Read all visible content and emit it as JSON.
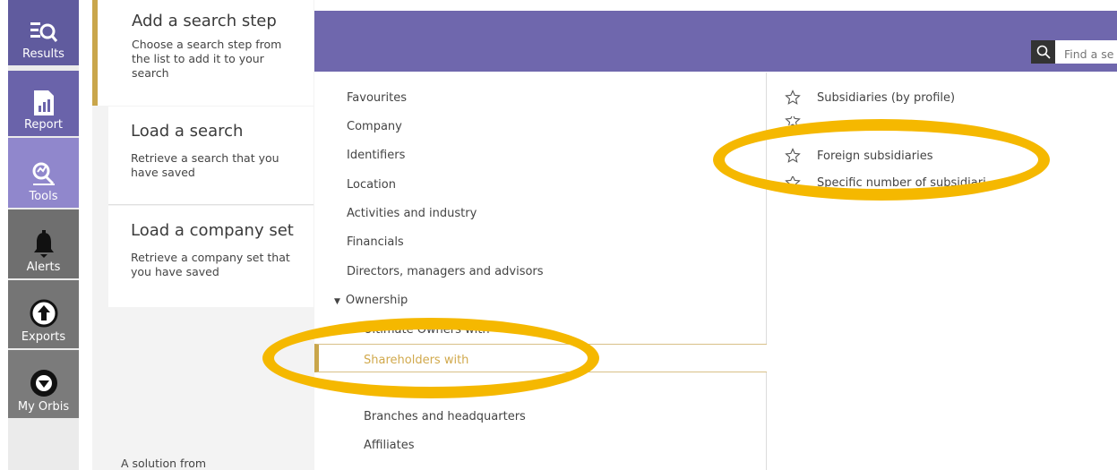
{
  "nav": {
    "results_label": "Results",
    "report_label": "Report",
    "tools_label": "Tools",
    "alerts_label": "Alerts",
    "exports_label": "Exports",
    "myorbis_label": "My Orbis"
  },
  "steps": {
    "add": {
      "title": "Add a search step",
      "desc": "Choose a search step from the list to add it to your search"
    },
    "load_search": {
      "title": "Load a search",
      "desc": "Retrieve a search that you have saved"
    },
    "load_company_set": {
      "title": "Load a company set",
      "desc": "Retrieve a company set that you have saved"
    },
    "solution_text": "A solution from"
  },
  "search": {
    "placeholder": "Find a se"
  },
  "categories": {
    "favourites": "Favourites",
    "company": "Company",
    "identifiers": "Identifiers",
    "location": "Location",
    "activities": "Activities and industry",
    "financials": "Financials",
    "directors": "Directors, managers and advisors",
    "ownership": "Ownership",
    "ownership_sub": {
      "ultimate_owners": "Ultimate Owners with",
      "shareholders": "Shareholders with",
      "branches": "Branches and headquarters",
      "affiliates": "Affiliates"
    }
  },
  "options": {
    "subsidiaries_profile": "Subsidiaries (by profile)",
    "foreign_subsidiaries": "Foreign subsidiaries",
    "specific_number": "Specific number of subsidiari"
  },
  "colors": {
    "header": "#6f67ad",
    "accent_gold": "#c9a64b",
    "highlight_yellow": "#f5b800"
  }
}
